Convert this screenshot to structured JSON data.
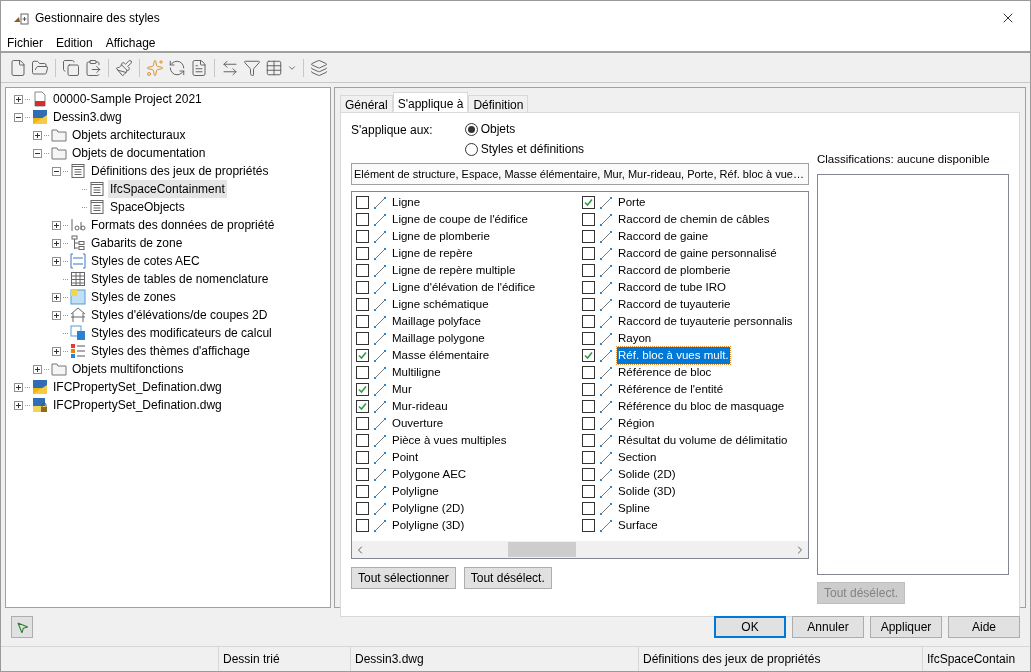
{
  "window": {
    "title": "Gestionnaire des styles"
  },
  "menu": [
    "Fichier",
    "Edition",
    "Affichage"
  ],
  "tree": [
    {
      "label": "00000-Sample Project 2021",
      "kind": "project",
      "expanded": false,
      "selected": false
    },
    {
      "label": "Dessin3.dwg",
      "kind": "drawing",
      "expanded": true,
      "selected": false,
      "children": [
        {
          "label": "Objets architecturaux",
          "kind": "folder",
          "expanded": false,
          "selected": false
        },
        {
          "label": "Objets de documentation",
          "kind": "folder",
          "expanded": true,
          "selected": false,
          "children": [
            {
              "label": "Définitions des jeux de propriétés",
              "kind": "list",
              "expanded": true,
              "selected": false,
              "children": [
                {
                  "label": "IfcSpaceContainment",
                  "kind": "list",
                  "selected": true
                },
                {
                  "label": "SpaceObjects",
                  "kind": "list",
                  "selected": false
                }
              ]
            },
            {
              "label": "Formats des données de propriété",
              "kind": "format",
              "expanded": false,
              "selected": false
            },
            {
              "label": "Gabarits de zone",
              "kind": "template",
              "expanded": false,
              "selected": false
            },
            {
              "label": "Styles de cotes AEC",
              "kind": "dimension",
              "expanded": false,
              "selected": false
            },
            {
              "label": "Styles de tables de nomenclature",
              "kind": "table",
              "selected": false
            },
            {
              "label": "Styles de zones",
              "kind": "zones",
              "expanded": false,
              "selected": false
            },
            {
              "label": "Styles d'élévations/de coupes 2D",
              "kind": "elevation",
              "expanded": false,
              "selected": false
            },
            {
              "label": "Styles des modificateurs de calcul",
              "kind": "calc",
              "selected": false
            },
            {
              "label": "Styles des thèmes d'affichage",
              "kind": "theme",
              "expanded": false,
              "selected": false
            }
          ]
        },
        {
          "label": "Objets multifonctions",
          "kind": "folder",
          "expanded": false,
          "selected": false
        }
      ]
    },
    {
      "label": "IFCPropertySet_Defination.dwg",
      "kind": "drawing",
      "expanded": false,
      "selected": false
    },
    {
      "label": "IFCPropertySet_Defination.dwg",
      "kind": "locked-drawing",
      "expanded": false,
      "selected": false
    }
  ],
  "tabs": [
    {
      "label": "Général",
      "selected": false
    },
    {
      "label": "S'applique à",
      "selected": true
    },
    {
      "label": "Définition",
      "selected": false
    }
  ],
  "applies_to": {
    "label": "S'applique aux:",
    "options": [
      {
        "label": "Objets",
        "selected": true
      },
      {
        "label": "Styles et définitions",
        "selected": false
      }
    ]
  },
  "summary": "Elément de structure, Espace, Masse élémentaire, Mur, Mur-rideau, Porte, Réf. bloc à vue…",
  "objects_left": [
    {
      "label": "Ligne",
      "checked": false,
      "selected": false
    },
    {
      "label": "Ligne de coupe de l'édifice",
      "checked": false,
      "selected": false
    },
    {
      "label": "Ligne de plomberie",
      "checked": false,
      "selected": false
    },
    {
      "label": "Ligne de repère",
      "checked": false,
      "selected": false
    },
    {
      "label": "Ligne de repère multiple",
      "checked": false,
      "selected": false
    },
    {
      "label": "Ligne d'élévation de l'édifice",
      "checked": false,
      "selected": false
    },
    {
      "label": "Ligne schématique",
      "checked": false,
      "selected": false
    },
    {
      "label": "Maillage polyface",
      "checked": false,
      "selected": false
    },
    {
      "label": "Maillage polygone",
      "checked": false,
      "selected": false
    },
    {
      "label": "Masse élémentaire",
      "checked": true,
      "selected": false
    },
    {
      "label": "Multiligne",
      "checked": false,
      "selected": false
    },
    {
      "label": "Mur",
      "checked": true,
      "selected": false
    },
    {
      "label": "Mur-rideau",
      "checked": true,
      "selected": false
    },
    {
      "label": "Ouverture",
      "checked": false,
      "selected": false
    },
    {
      "label": "Pièce à vues multiples",
      "checked": false,
      "selected": false
    },
    {
      "label": "Point",
      "checked": false,
      "selected": false
    },
    {
      "label": "Polygone AEC",
      "checked": false,
      "selected": false
    },
    {
      "label": "Polyligne",
      "checked": false,
      "selected": false
    },
    {
      "label": "Polyligne (2D)",
      "checked": false,
      "selected": false
    },
    {
      "label": "Polyligne (3D)",
      "checked": false,
      "selected": false
    }
  ],
  "objects_right": [
    {
      "label": "Porte",
      "checked": true,
      "selected": false
    },
    {
      "label": "Raccord de chemin de câbles",
      "checked": false,
      "selected": false
    },
    {
      "label": "Raccord de gaine",
      "checked": false,
      "selected": false
    },
    {
      "label": "Raccord de gaine personnalisé",
      "checked": false,
      "selected": false
    },
    {
      "label": "Raccord de plomberie",
      "checked": false,
      "selected": false
    },
    {
      "label": "Raccord de tube IRO",
      "checked": false,
      "selected": false
    },
    {
      "label": "Raccord de tuyauterie",
      "checked": false,
      "selected": false
    },
    {
      "label": "Raccord de tuyauterie personnalis",
      "checked": false,
      "selected": false
    },
    {
      "label": "Rayon",
      "checked": false,
      "selected": false
    },
    {
      "label": "Réf. bloc à vues mult.",
      "checked": true,
      "selected": true
    },
    {
      "label": "Référence de bloc",
      "checked": false,
      "selected": false
    },
    {
      "label": "Référence de l'entité",
      "checked": false,
      "selected": false
    },
    {
      "label": "Référence du bloc de masquage",
      "checked": false,
      "selected": false
    },
    {
      "label": "Région",
      "checked": false,
      "selected": false
    },
    {
      "label": "Résultat du volume de délimitatio",
      "checked": false,
      "selected": false
    },
    {
      "label": "Section",
      "checked": false,
      "selected": false
    },
    {
      "label": "Solide (2D)",
      "checked": false,
      "selected": false
    },
    {
      "label": "Solide (3D)",
      "checked": false,
      "selected": false
    },
    {
      "label": "Spline",
      "checked": false,
      "selected": false
    },
    {
      "label": "Surface",
      "checked": false,
      "selected": false
    }
  ],
  "list_buttons": [
    "Tout sélectionner",
    "Tout désélect."
  ],
  "classifications": {
    "label": "Classifications: aucune disponible",
    "button": {
      "label": "Tout désélect.",
      "disabled": true
    }
  },
  "dialog_buttons": [
    {
      "label": "OK",
      "default": true
    },
    {
      "label": "Annuler",
      "default": false
    },
    {
      "label": "Appliquer",
      "default": false
    },
    {
      "label": "Aide",
      "default": false
    }
  ],
  "status_bar": [
    "Dessin trié",
    "Dessin3.dwg",
    "Définitions des jeux de propriétés",
    "IfcSpaceContain"
  ]
}
